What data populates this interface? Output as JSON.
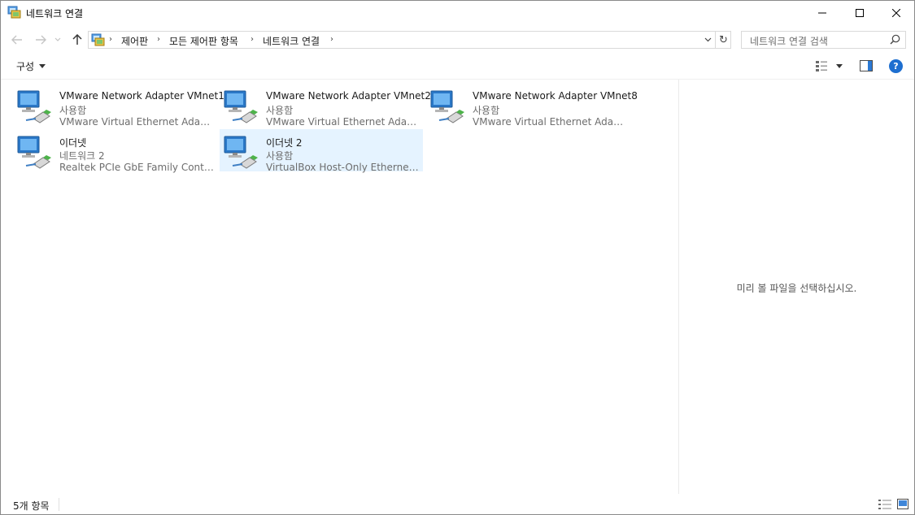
{
  "window": {
    "title": "네트워크 연결"
  },
  "address": {
    "breadcrumbs": [
      "제어판",
      "모든 제어판 항목",
      "네트워크 연결"
    ],
    "refresh_glyph": "↻"
  },
  "search": {
    "placeholder": "네트워크 연결 검색"
  },
  "toolbar": {
    "organize_label": "구성",
    "help_label": "?"
  },
  "connections": [
    {
      "name": "VMware Network Adapter VMnet1",
      "status": "사용함",
      "device": "VMware Virtual Ethernet Adapter...",
      "selected": false
    },
    {
      "name": "VMware Network Adapter VMnet2",
      "status": "사용함",
      "device": "VMware Virtual Ethernet Adapter...",
      "selected": false
    },
    {
      "name": "VMware Network Adapter VMnet8",
      "status": "사용함",
      "device": "VMware Virtual Ethernet Adapter...",
      "selected": false
    },
    {
      "name": "이더넷",
      "status": "네트워크 2",
      "device": "Realtek PCIe GbE Family Controller",
      "selected": false
    },
    {
      "name": "이더넷 2",
      "status": "사용함",
      "device": "VirtualBox Host-Only Ethernet A...",
      "selected": true
    }
  ],
  "preview": {
    "message": "미리 볼 파일을 선택하십시오."
  },
  "status": {
    "item_count": "5개 항목"
  },
  "colors": {
    "selection": "#e5f3ff",
    "accent": "#1e6fd0"
  }
}
